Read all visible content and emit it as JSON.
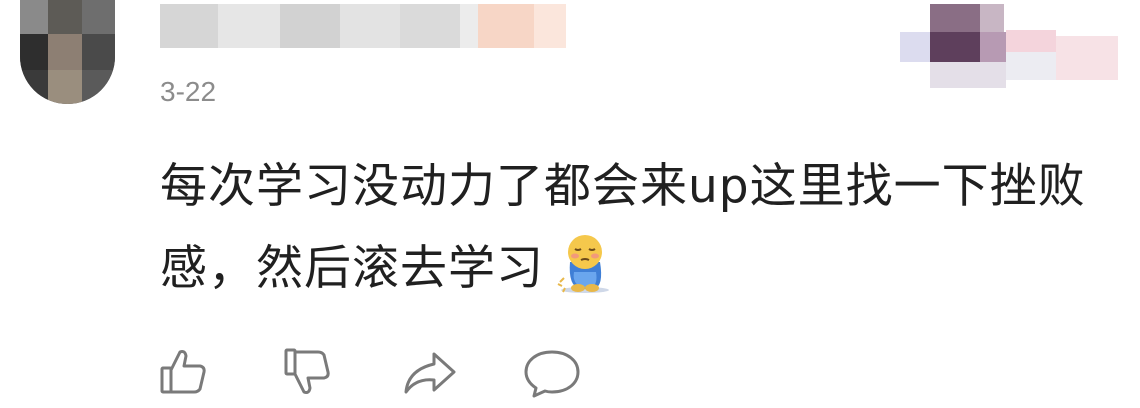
{
  "comment": {
    "date": "3-22",
    "text": "每次学习没动力了都会来up这里找一下挫败感，然后滚去学习",
    "emoji": "face-with-blush-sitting-emoji",
    "avatar_icon": "user-avatar",
    "actions": [
      {
        "icon": "thumbs-up-icon"
      },
      {
        "icon": "thumbs-down-icon"
      },
      {
        "icon": "share-icon"
      },
      {
        "icon": "comment-bubble-icon"
      }
    ]
  },
  "colors": {
    "text": "#202020",
    "meta": "#8c8c8c",
    "icon": "#7a7a7a",
    "background": "#ffffff"
  }
}
